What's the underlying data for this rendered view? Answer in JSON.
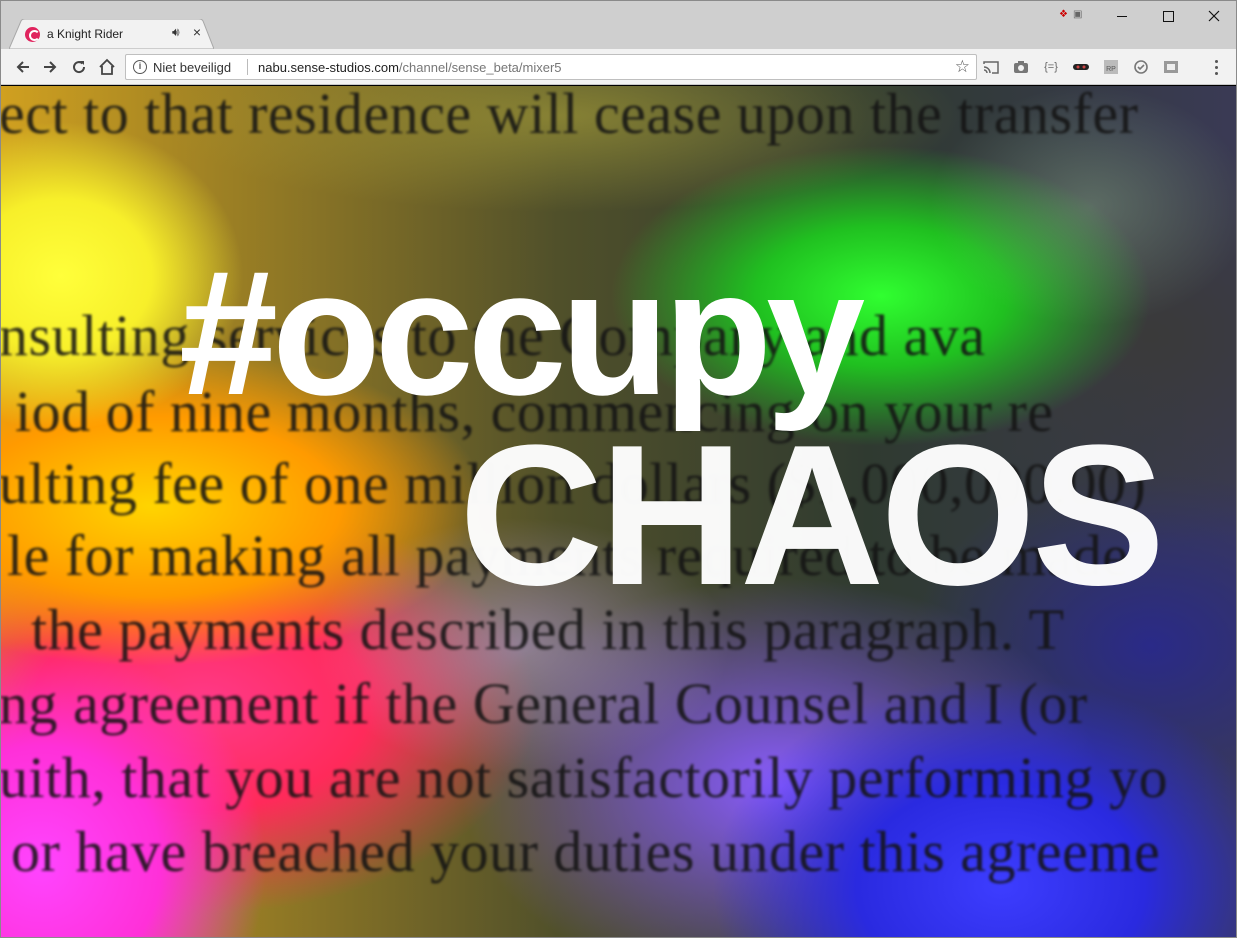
{
  "browser": {
    "tab": {
      "title": "a Knight Rider",
      "audio_icon": "speaker-icon",
      "close_label": "×"
    },
    "window_controls": {
      "close_label": "✕"
    },
    "omnibox": {
      "security_label": "Niet beveiligd",
      "url_host": "nabu.sense-studios.com",
      "url_path": "/channel/sense_beta/mixer5",
      "star_icon": "bookmark-star-icon"
    },
    "extensions": [
      "cast-icon",
      "camera-icon",
      "json-icon",
      "mask-icon",
      "rp-icon",
      "check-icon",
      "window-icon"
    ]
  },
  "page": {
    "document_lines": [
      "ect to that residence will cease upon the transfer",
      "nsulting services to the Company and ava",
      "iod of nine months, commencing on your re",
      "ulting fee of one million dollars ($1,000,000.00)",
      "le for making all payments required to be made",
      "the payments described in this paragraph.  T",
      "ng agreement if the General Counsel and I (or",
      "uith, that you are not satisfactorily performing yo",
      "or have breached your duties under this agreeme"
    ],
    "overlay_word_1": "#occupy",
    "overlay_word_2": "CHAOS"
  }
}
